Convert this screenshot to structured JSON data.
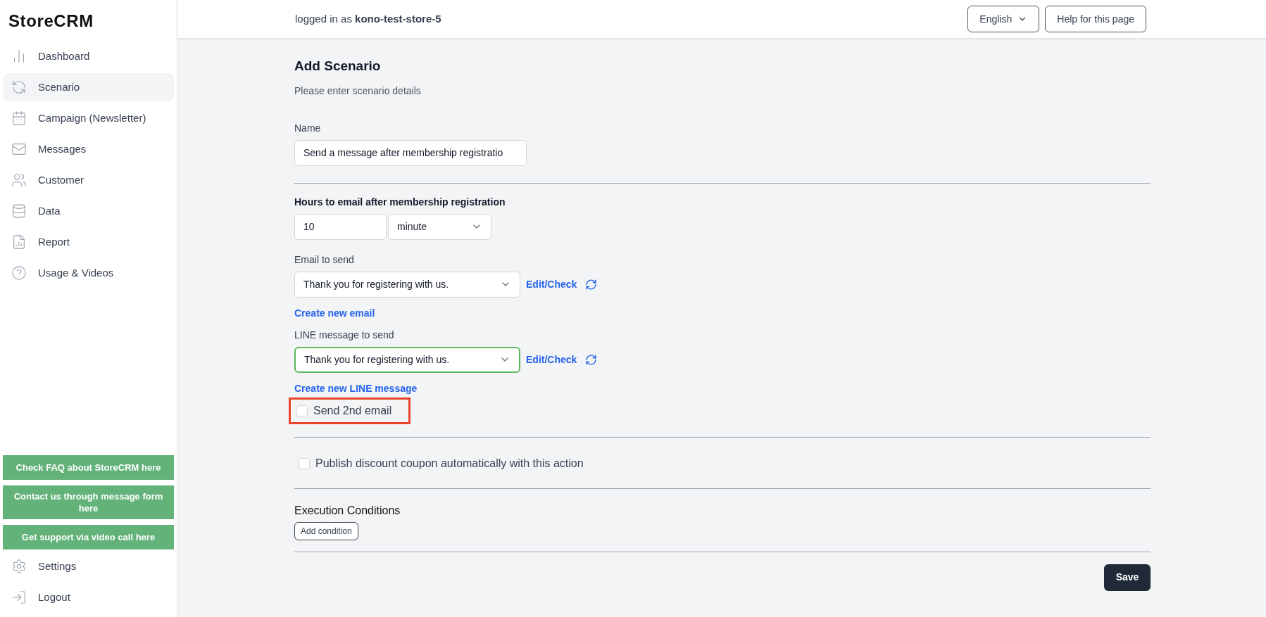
{
  "sidebar": {
    "logo": "StoreCRM",
    "items": [
      {
        "label": "Dashboard",
        "selected": false
      },
      {
        "label": "Scenario",
        "selected": true
      },
      {
        "label": "Campaign (Newsletter)",
        "selected": false
      },
      {
        "label": "Messages",
        "selected": false
      },
      {
        "label": "Customer",
        "selected": false
      },
      {
        "label": "Data",
        "selected": false
      },
      {
        "label": "Report",
        "selected": false
      },
      {
        "label": "Usage & Videos",
        "selected": false
      }
    ],
    "support_buttons": [
      "Check FAQ about StoreCRM here",
      "Contact us through message form here",
      "Get support via video call here"
    ],
    "bottom_items": [
      {
        "label": "Settings",
        "selected": false
      },
      {
        "label": "Logout",
        "selected": false
      }
    ]
  },
  "header": {
    "login_text": "logged in as **kono-test-store-5**",
    "language": "English",
    "help_button": "Help for this page"
  },
  "form": {
    "title": "Add Scenario",
    "subtitle": "Please enter scenario details",
    "name": {
      "label": "Name",
      "value": "Send a message after membership registratio"
    },
    "hours": {
      "label": "Hours to email after membership registration",
      "value": "10",
      "unit": "minute"
    },
    "email": {
      "label": "Email to send",
      "value": "Thank you for registering with us.",
      "focused": false,
      "edit_link": "Edit/Check",
      "create_link": "Create new email"
    },
    "line": {
      "label": "LINE message to send",
      "value": "Thank you for registering with us.",
      "focused": true,
      "edit_link": "Edit/Check",
      "create_link": "Create new LINE message"
    },
    "second_email": {
      "label": "Send 2nd email",
      "checked": false,
      "highlighted": true
    },
    "coupon": {
      "label": "Publish discount coupon automatically with this action",
      "checked": false
    },
    "conditions": {
      "title": "Execution Conditions",
      "button": "Add condition"
    },
    "save": "Save"
  }
}
